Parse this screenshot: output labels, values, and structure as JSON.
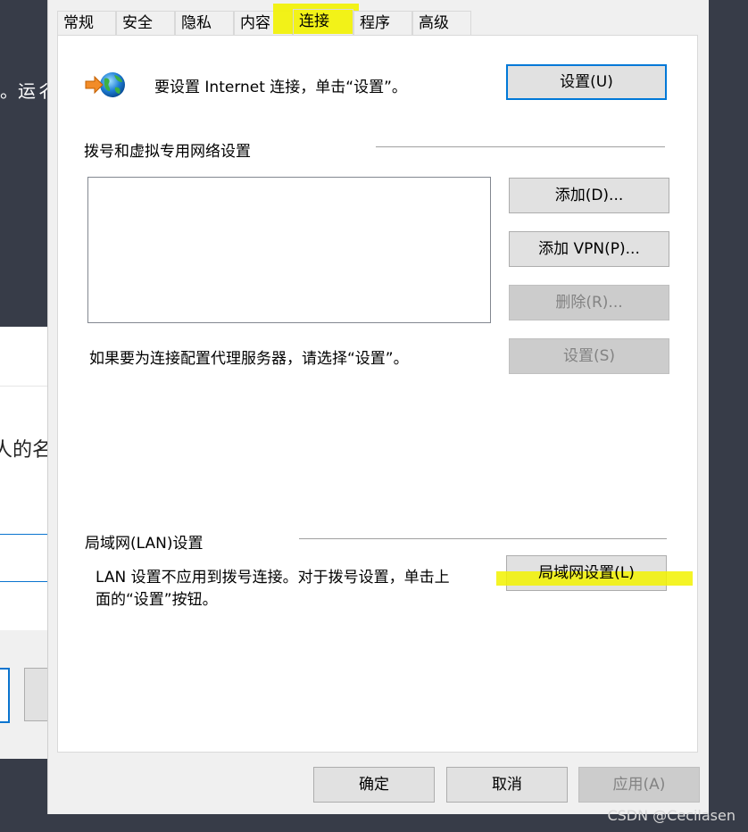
{
  "background": {
    "top_text": "。运彳",
    "window_text_line1": "人的名",
    "window_text_line2": "。"
  },
  "dialog": {
    "tabs": [
      {
        "label": "常规"
      },
      {
        "label": "安全"
      },
      {
        "label": "隐私"
      },
      {
        "label": "内容"
      },
      {
        "label": "连接",
        "active": true
      },
      {
        "label": "程序"
      },
      {
        "label": "高级"
      }
    ],
    "internet_setup": {
      "text": "要设置 Internet 连接，单击“设置”。",
      "setup_button": "设置(U)"
    },
    "dialup_vpn": {
      "header": "拨号和虚拟专用网络设置",
      "add_button": "添加(D)...",
      "add_vpn_button": "添加 VPN(P)...",
      "delete_button": "删除(R)...",
      "settings_button": "设置(S)",
      "proxy_hint": "如果要为连接配置代理服务器，请选择“设置”。"
    },
    "lan": {
      "header": "局域网(LAN)设置",
      "description_line1": "LAN 设置不应用到拨号连接。对于拨号设置，单击上",
      "description_line2": "面的“设置”按钮。",
      "lan_settings_button": "局域网设置(L)"
    },
    "footer": {
      "ok_button": "确定",
      "cancel_button": "取消",
      "apply_button": "应用(A)"
    }
  },
  "watermark": "CSDN @Cecilasen",
  "colors": {
    "highlight": "#f2f200",
    "accent": "#0078d7",
    "desktop": "#373c48"
  }
}
